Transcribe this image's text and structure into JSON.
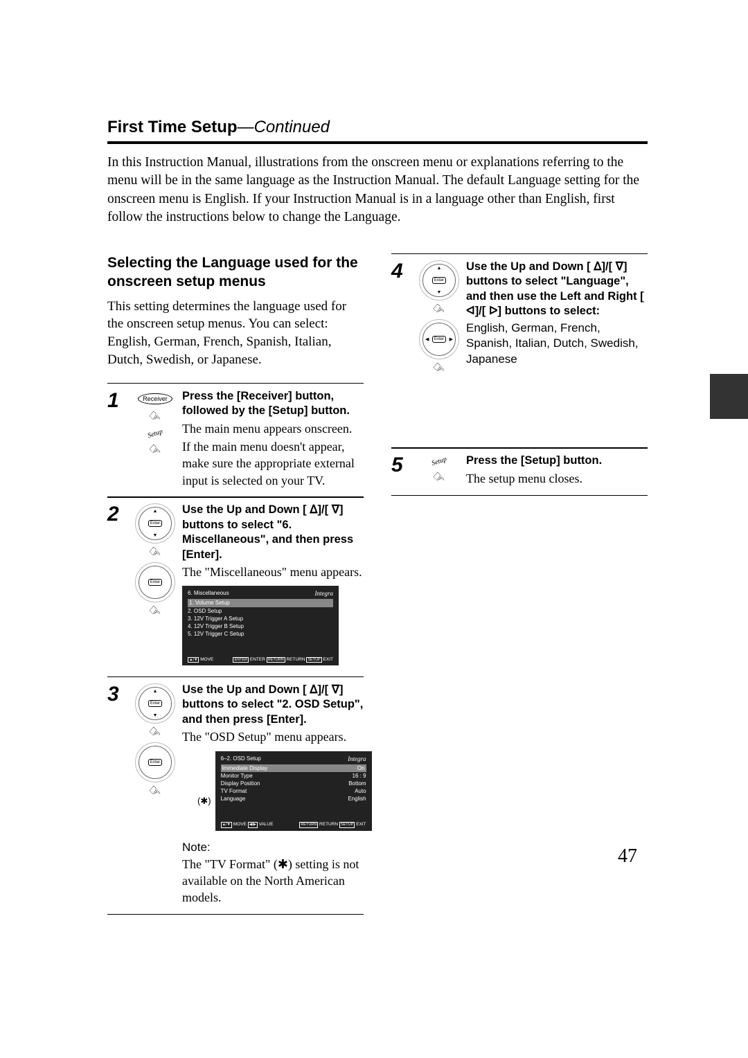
{
  "header": {
    "title": "First Time Setup",
    "continued": "—Continued"
  },
  "intro": "In this Instruction Manual, illustrations from the onscreen menu or explanations referring to the menu will be in the same language as the Instruction Manual. The default Language setting for the onscreen menu is English. If your Instruction Manual is in a language other than English, first follow the instructions below to change the Language.",
  "left": {
    "heading": "Selecting the Language used for the onscreen setup menus",
    "body": "This setting determines the language used for the onscreen setup menus. You can select: English, German, French, Spanish, Italian, Dutch, Swedish, or Japanese."
  },
  "steps": {
    "s1": {
      "num": "1",
      "bold": "Press the [Receiver] button, followed by the [Setup] button.",
      "body1": "The main menu appears onscreen.",
      "body2": "If the main menu doesn't appear, make sure the appropriate external input is selected on your TV.",
      "icon1": "Receiver",
      "icon2": "Setup"
    },
    "s2": {
      "num": "2",
      "bold": "Use the Up and Down [ ᐃ]/[ ᐁ] buttons to select \"6. Miscellaneous\", and then press [Enter].",
      "body": "The \"Miscellaneous\" menu appears.",
      "screen": {
        "title": "6.   Miscellaneous",
        "brand": "Integra",
        "items": [
          "1.   Volume Setup",
          "2.   OSD Setup",
          "3.   12V Trigger A  Setup",
          "4.   12V Trigger B  Setup",
          "5.   12V Trigger C  Setup"
        ],
        "foot_left_k": "▲/▼",
        "foot_left": "MOVE",
        "foot_r1k": "ENTER",
        "foot_r1": "ENTER",
        "foot_r2k": "RETURN",
        "foot_r2": "RETURN",
        "foot_r3k": "SETUP",
        "foot_r3": "EXIT"
      }
    },
    "s3": {
      "num": "3",
      "bold": "Use the Up and Down [ ᐃ]/[ ᐁ] buttons to select \"2. OSD Setup\", and then press [Enter].",
      "body": "The \"OSD Setup\" menu appears.",
      "aster": "(✱)",
      "screen": {
        "title": "6–2.   OSD Setup",
        "brand": "Integra",
        "rows": [
          {
            "k": "Immediate Display",
            "v": "On"
          },
          {
            "k": "Monitor Type",
            "v": "16 : 9"
          },
          {
            "k": "Display Position",
            "v": "Bottom"
          },
          {
            "k": "TV Format",
            "v": "Auto"
          },
          {
            "k": "Language",
            "v": "English"
          }
        ],
        "foot_left_k": "▲/▼",
        "foot_left_t": "MOVE",
        "foot_left_k2": "◀/▶",
        "foot_left_t2": "VALUE",
        "foot_r2k": "RETURN",
        "foot_r2": "RETURN",
        "foot_r3k": "SETUP",
        "foot_r3": "EXIT"
      },
      "note_label": "Note:",
      "note_body": "The \"TV Format\" (✱) setting is not available on the North American models."
    },
    "s4": {
      "num": "4",
      "bold": "Use the Up and Down [ ᐃ]/[ ᐁ] buttons to select \"Language\", and then use the Left and Right [ ᐊ]/[ ᐅ] buttons to select:",
      "body": "English, German, French, Spanish, Italian, Dutch, Swedish, Japanese"
    },
    "s5": {
      "num": "5",
      "bold": "Press the [Setup] button.",
      "body": "The setup menu closes.",
      "icon": "Setup"
    }
  },
  "page_number": "47"
}
